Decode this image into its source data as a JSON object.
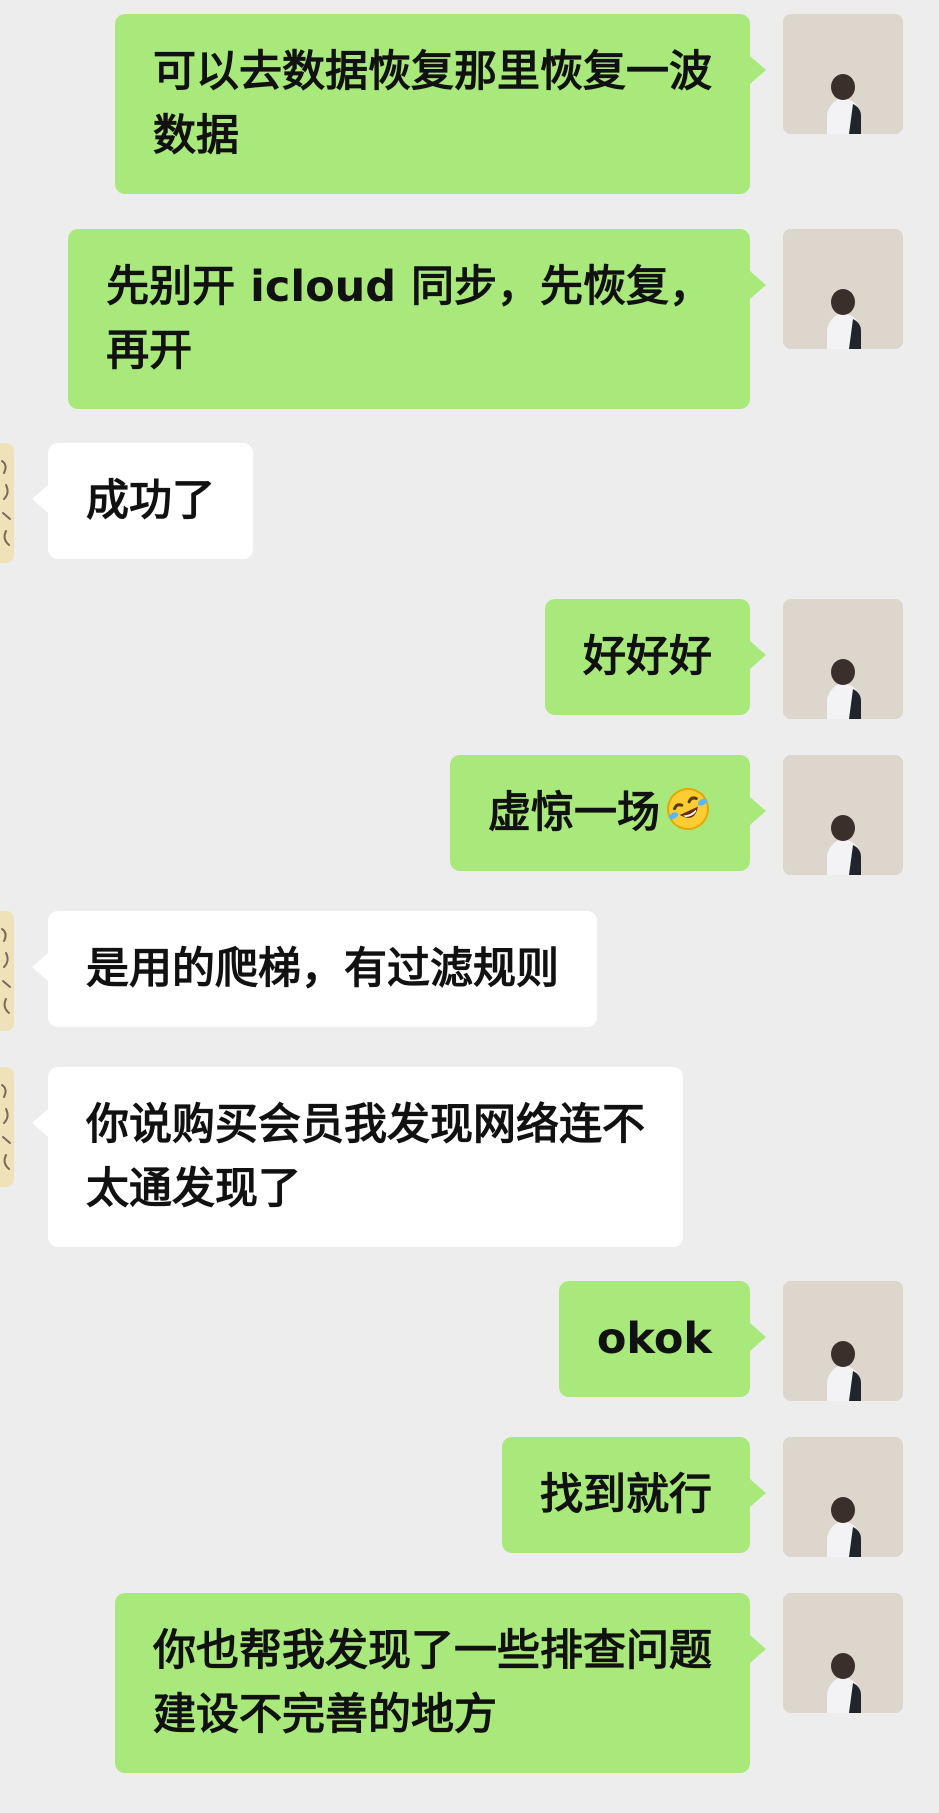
{
  "messages": [
    {
      "side": "sent",
      "lines": [
        "可以去数据恢复那里恢复一波",
        "数据"
      ]
    },
    {
      "side": "sent",
      "lines": [
        "先别开 icloud 同步，先恢复，",
        "再开"
      ]
    },
    {
      "side": "recv",
      "lines": [
        "成功了"
      ]
    },
    {
      "side": "sent",
      "lines": [
        "好好好"
      ]
    },
    {
      "side": "sent",
      "lines": [
        "虚惊一场"
      ],
      "emoji": "rolling-on-floor-laughing-emoji"
    },
    {
      "side": "recv",
      "lines": [
        "是用的爬梯，有过滤规则"
      ]
    },
    {
      "side": "recv",
      "lines": [
        "你说购买会员我发现网络连不",
        "太通发现了"
      ]
    },
    {
      "side": "sent",
      "lines": [
        "okok"
      ]
    },
    {
      "side": "sent",
      "lines": [
        "找到就行"
      ]
    },
    {
      "side": "sent",
      "lines": [
        "你也帮我发现了一些排查问题",
        "建设不完善的地方"
      ]
    }
  ],
  "colors": {
    "background": "#ededed",
    "sent_bubble": "#a9e97c",
    "received_bubble": "#ffffff",
    "text": "#111111"
  },
  "icons": {
    "self_avatar": "person-avatar-icon",
    "contact_avatar": "contact-avatar-icon"
  }
}
